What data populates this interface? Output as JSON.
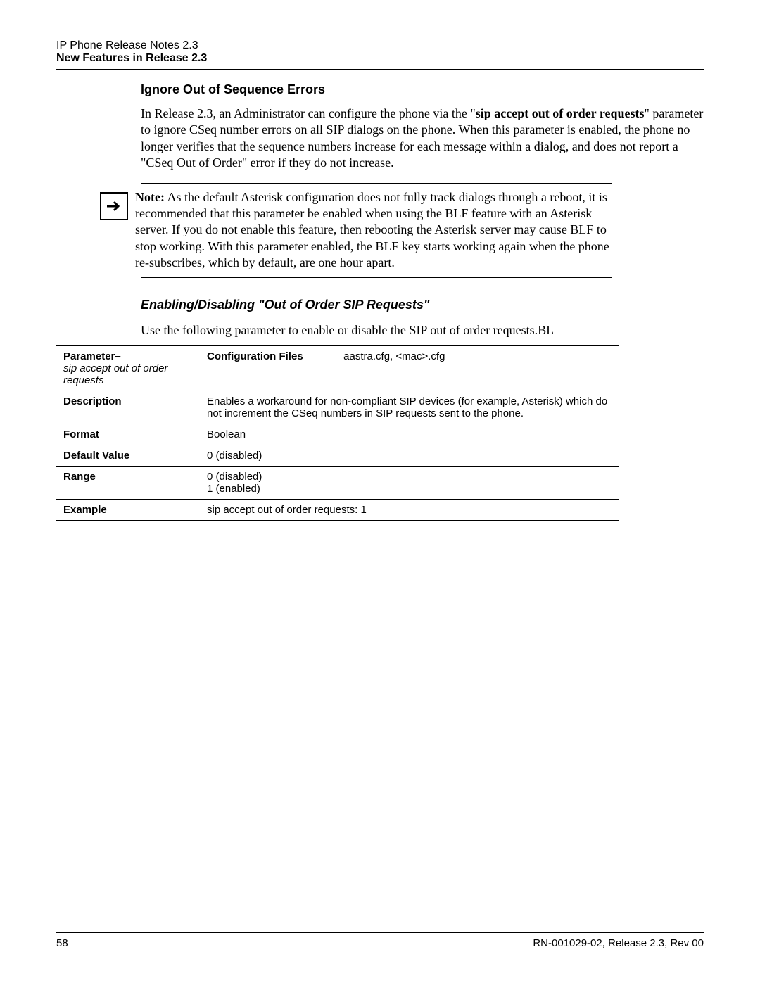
{
  "header": {
    "line1": "IP Phone Release Notes 2.3",
    "line2": "New Features in Release 2.3"
  },
  "section1": {
    "heading": "Ignore Out of Sequence Errors",
    "para_before": "In Release 2.3, an Administrator can configure the phone via the \"",
    "para_bold": "sip accept out of order requests",
    "para_after": "\" parameter to ignore CSeq number errors on all SIP dialogs on the phone. When this parameter is enabled, the phone no longer verifies that the sequence numbers increase for each message within a dialog, and does not report a \"CSeq Out of Order\" error if they do not increase."
  },
  "note": {
    "label": "Note:",
    "text": " As the default Asterisk configuration does not fully track dialogs through a reboot, it is recommended that this parameter be enabled when using the BLF feature with an Asterisk server. If you do not enable this feature, then rebooting the Asterisk server may cause BLF to stop working. With this parameter enabled, the BLF key starts working again when the phone re-subscribes, which by default, are one hour apart."
  },
  "section2": {
    "heading": "Enabling/Disabling \"Out of Order SIP Requests\"",
    "intro": "Use the following parameter to enable or disable the SIP out of order requests.BL"
  },
  "table": {
    "row1": {
      "label_prefix": "Parameter–",
      "param_name": "sip accept out of order requests",
      "conf_label": "Configuration Files",
      "conf_value": "aastra.cfg, <mac>.cfg"
    },
    "row2": {
      "label": "Description",
      "value": "Enables a workaround for non-compliant SIP devices (for example, Asterisk) which do not increment the CSeq numbers in SIP requests sent to the phone."
    },
    "row3": {
      "label": "Format",
      "value": "Boolean"
    },
    "row4": {
      "label": "Default Value",
      "value": "0 (disabled)"
    },
    "row5": {
      "label": "Range",
      "value_line1": "0 (disabled)",
      "value_line2": "1 (enabled)"
    },
    "row6": {
      "label": "Example",
      "value": "sip accept out of order requests: 1"
    }
  },
  "footer": {
    "page_number": "58",
    "doc_id": "RN-001029-02, Release 2.3, Rev 00"
  }
}
